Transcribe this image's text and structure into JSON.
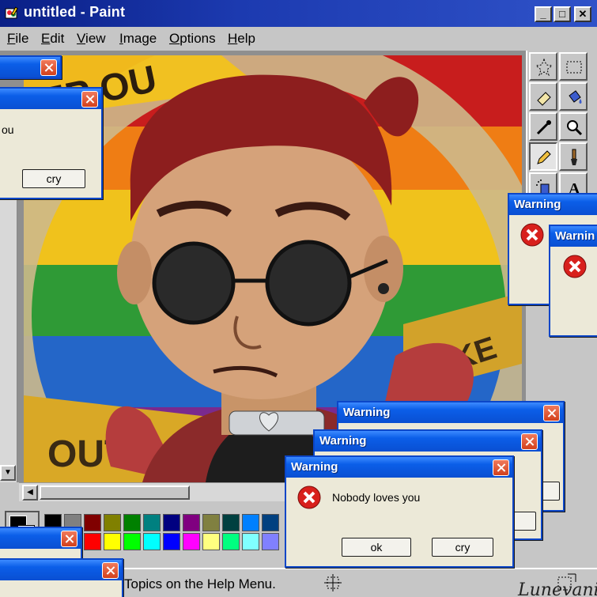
{
  "window": {
    "title": "untitled - Paint",
    "icon": "paint-app-icon",
    "controls": {
      "minimize": "_",
      "maximize": "□",
      "close": "✕"
    }
  },
  "menu": [
    "File",
    "Edit",
    "View",
    "Image",
    "Options",
    "Help"
  ],
  "status_bar": {
    "text": "Topics on the Help Menu.",
    "signature": "Lunevani"
  },
  "palette": [
    "#000000",
    "#808080",
    "#800000",
    "#808000",
    "#008000",
    "#008080",
    "#000080",
    "#800080",
    "#808040",
    "#004040",
    "#0080ff",
    "#004080",
    "#ffffff",
    "#c0c0c0",
    "#ff0000",
    "#ffff00",
    "#00ff00",
    "#00ffff",
    "#0000ff",
    "#ff00ff",
    "#ffff80",
    "#00ff80",
    "#80ffff",
    "#8080ff"
  ],
  "tools": [
    "free-select-icon",
    "rect-select-icon",
    "eraser-icon",
    "fill-bucket-icon",
    "color-picker-icon",
    "magnifier-icon",
    "pencil-icon",
    "brush-icon",
    "airbrush-icon",
    "text-icon"
  ],
  "dialogs": {
    "partial_cry": {
      "message_fragment": "ou",
      "cry_label": "cry"
    },
    "warning_right_1": {
      "title": "Warning"
    },
    "warning_right_2": {
      "title": "Warnin"
    },
    "warning_back": {
      "title": "Warning"
    },
    "warning_mid": {
      "title": "Warning"
    },
    "warning_front": {
      "title": "Warning",
      "message": "Nobody loves you",
      "ok_label": "ok",
      "cry_label": "cry"
    }
  },
  "colors": {
    "titlebar": "#0a1f86",
    "dialog_title": "#0b5ee8",
    "dialog_body": "#ece9d8",
    "error_red": "#d8201c"
  }
}
